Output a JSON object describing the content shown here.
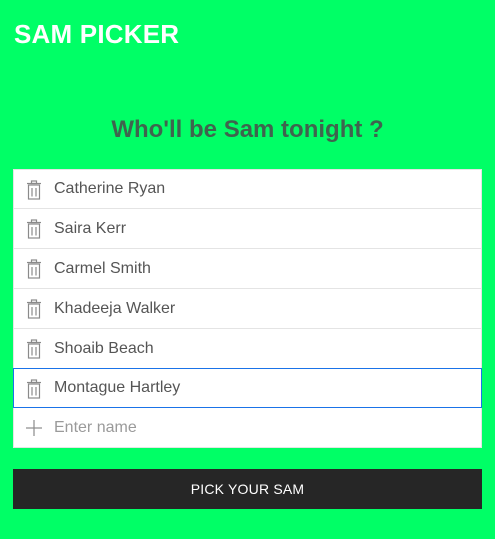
{
  "app": {
    "title": "SAM PICKER"
  },
  "main": {
    "question": "Who'll be Sam tonight ?",
    "people": [
      {
        "name": "Catherine Ryan",
        "icon": "trash-icon"
      },
      {
        "name": "Saira Kerr",
        "icon": "trash-icon"
      },
      {
        "name": "Carmel Smith",
        "icon": "trash-icon"
      },
      {
        "name": "Khadeeja Walker",
        "icon": "trash-icon"
      },
      {
        "name": "Shoaib Beach",
        "icon": "trash-icon"
      },
      {
        "name": "Montague Hartley",
        "icon": "trash-icon"
      }
    ],
    "add": {
      "icon": "plus-icon",
      "placeholder": "Enter name",
      "value": ""
    },
    "pick_button_label": "PICK YOUR SAM"
  },
  "colors": {
    "background": "#00ff66",
    "button": "#262626",
    "focus_border": "#1a73e8"
  }
}
